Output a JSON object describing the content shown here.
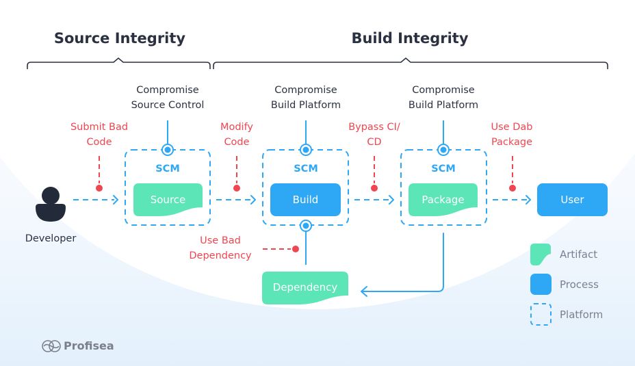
{
  "colors": {
    "artifact": "#5ce5b7",
    "process": "#2ea7f5",
    "platform": "#2ea7f5",
    "attack": "#ef4650",
    "text": "#2b3140",
    "muted": "#7b8090"
  },
  "sections": {
    "source_integrity": "Source Integrity",
    "build_integrity": "Build Integrity"
  },
  "developer": {
    "label": "Developer",
    "icon": "person-icon"
  },
  "threats": [
    {
      "line1": "Compromise",
      "line2": "Source Control"
    },
    {
      "line1": "Compromise",
      "line2": "Build Platform"
    },
    {
      "line1": "Compromise",
      "line2": "Build Platform"
    }
  ],
  "attacks": [
    {
      "line1": "Submit Bad",
      "line2": "Code"
    },
    {
      "line1": "Modify",
      "line2": "Code"
    },
    {
      "line1": "Bypass CI/",
      "line2": "CD"
    },
    {
      "line1": "Use Dab",
      "line2": "Package"
    },
    {
      "line1": "Use Bad",
      "line2": "Dependency"
    }
  ],
  "platforms": [
    {
      "label": "SCM"
    },
    {
      "label": "SCM"
    },
    {
      "label": "SCM"
    }
  ],
  "nodes": {
    "source": {
      "label": "Source",
      "type": "artifact"
    },
    "build": {
      "label": "Build",
      "type": "process"
    },
    "package": {
      "label": "Package",
      "type": "artifact"
    },
    "user": {
      "label": "User",
      "type": "process"
    },
    "dependency": {
      "label": "Dependency",
      "type": "artifact"
    }
  },
  "legend": [
    {
      "label": "Artifact",
      "type": "artifact"
    },
    {
      "label": "Process",
      "type": "process"
    },
    {
      "label": "Platform",
      "type": "platform"
    }
  ],
  "brand": {
    "name": "Profisea",
    "icon": "profisea-logo-icon"
  }
}
